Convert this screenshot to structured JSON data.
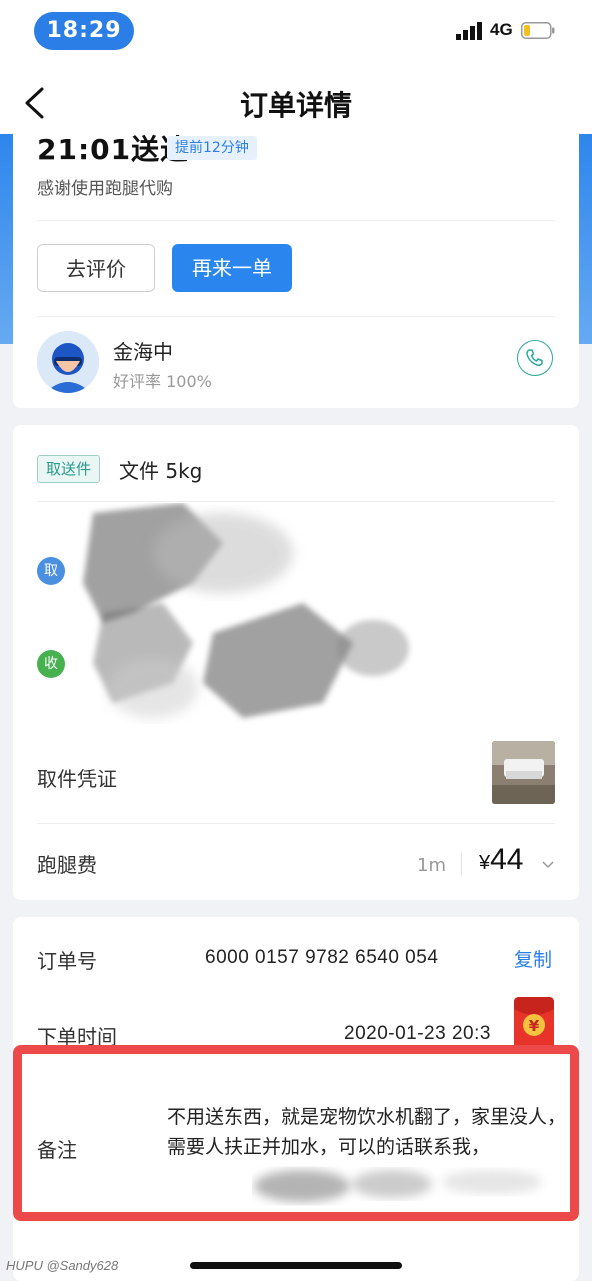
{
  "status_bar": {
    "time": "18:29",
    "network": "4G"
  },
  "header": {
    "title": "订单详情"
  },
  "delivery": {
    "arrive_time": "21:01送达",
    "early_badge": "提前12分钟",
    "thanks_text": "感谢使用跑腿代购",
    "review_button": "去评价",
    "reorder_button": "再来一单"
  },
  "rider": {
    "name": "金海中",
    "rating": "好评率 100%"
  },
  "item": {
    "type_badge": "取送件",
    "description": "文件 5kg",
    "pickup_dot": "取",
    "dropoff_dot": "收",
    "proof_label": "取件凭证",
    "fee_label": "跑腿费",
    "distance": "1m",
    "currency": "¥",
    "fee": "44"
  },
  "order": {
    "number_label": "订单号",
    "number_value": "6000 0157 9782 6540 054",
    "copy_link": "复制",
    "time_label": "下单时间",
    "time_value": "2020-01-23 20:3"
  },
  "note": {
    "label": "备注",
    "text": "不用送东西，就是宠物饮水机翻了，家里没人，需要人扶正并加水，可以的话联系我，"
  },
  "footer": {
    "watermark": "HUPU @Sandy628"
  },
  "colors": {
    "accent": "#2a86ee",
    "highlight": "#ec4a4a",
    "teal": "#2aa99a"
  }
}
